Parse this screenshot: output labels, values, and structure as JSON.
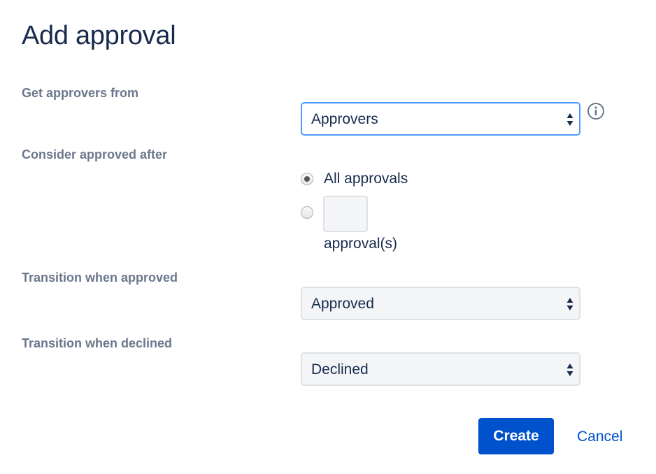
{
  "dialog": {
    "title": "Add approval"
  },
  "form": {
    "approvers_from": {
      "label": "Get approvers from",
      "value": "Approvers",
      "info_icon": "info-icon"
    },
    "consider_approved": {
      "label": "Consider approved after",
      "options": [
        {
          "label": "All approvals",
          "selected": true
        },
        {
          "label": "",
          "selected": false,
          "count_value": "",
          "suffix": "approval(s)"
        }
      ]
    },
    "transition_approved": {
      "label": "Transition when approved",
      "value": "Approved"
    },
    "transition_declined": {
      "label": "Transition when declined",
      "value": "Declined"
    }
  },
  "actions": {
    "create_label": "Create",
    "cancel_label": "Cancel"
  },
  "colors": {
    "primary": "#0052cc",
    "heading": "#172b4d",
    "label": "#6b778c",
    "focus_border": "#4c9aff",
    "field_background": "#f4f5f7"
  }
}
